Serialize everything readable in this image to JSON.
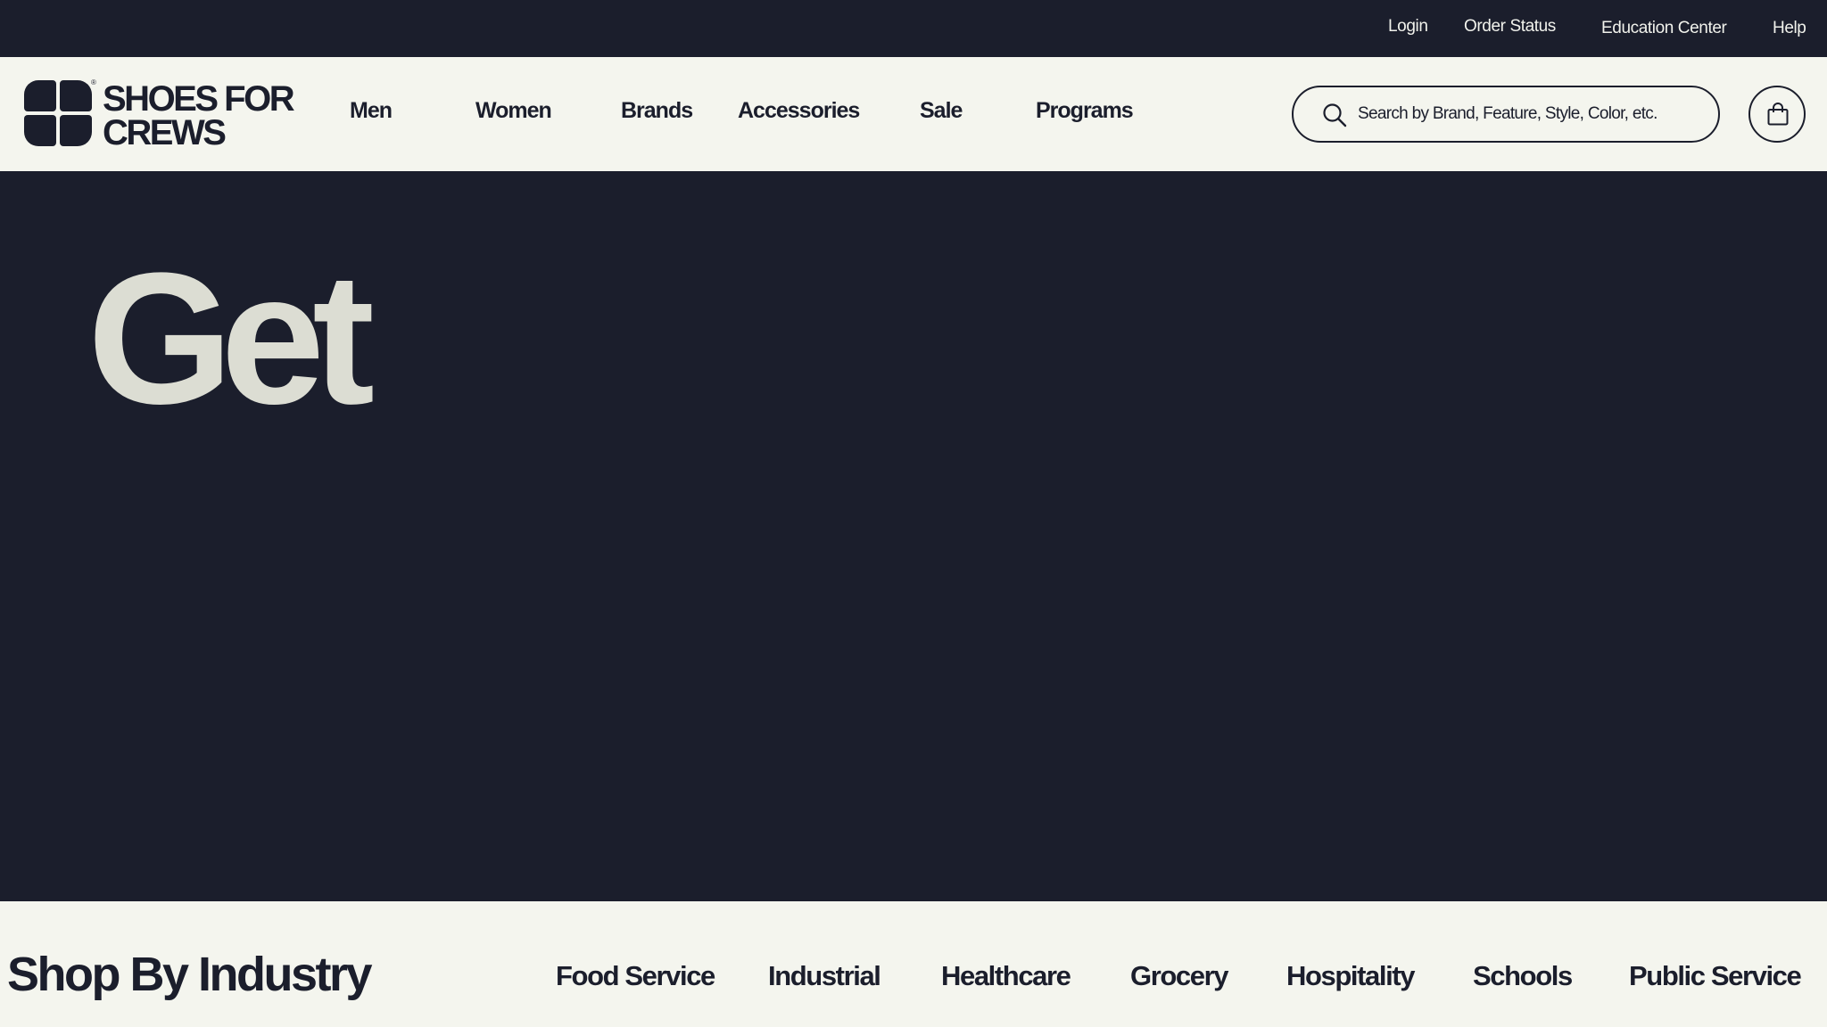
{
  "utility_nav": {
    "login": "Login",
    "order_status": "Order Status",
    "education_center": "Education Center",
    "help": "Help"
  },
  "header": {
    "logo": {
      "line1": "SHOES FOR",
      "line2": "CREWS",
      "registered": "®"
    },
    "nav": [
      "Men",
      "Women",
      "Brands",
      "Accessories",
      "Sale",
      "Programs"
    ],
    "search": {
      "placeholder": "Search by Brand, Feature, Style, Color, etc.",
      "value": "",
      "icon": "search-icon"
    },
    "cart": {
      "icon": "shopping-bag-icon"
    }
  },
  "hero": {
    "heading": "Get"
  },
  "industry": {
    "title": "Shop By Industry",
    "items": [
      "Food Service",
      "Industrial",
      "Healthcare",
      "Grocery",
      "Hospitality",
      "Schools",
      "Public Service"
    ]
  },
  "colors": {
    "navy": "#1b1e2c",
    "cream": "#f4f5ee",
    "hero_text": "#dcddd3"
  }
}
